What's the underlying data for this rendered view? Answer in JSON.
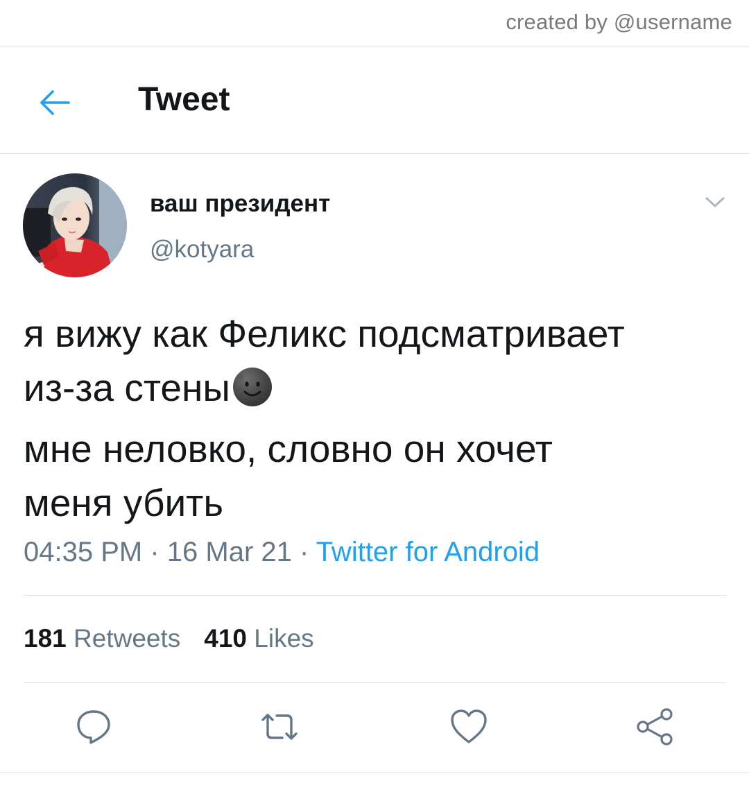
{
  "watermark": "created by @username",
  "header": {
    "title": "Tweet",
    "back_icon": "arrow-left-icon"
  },
  "tweet": {
    "author": {
      "display_name": "ваш президент",
      "handle": "@kotyara"
    },
    "text_lines": [
      "я вижу как Феликс подсматривает",
      "из-за стены",
      "мне неловко, словно он хочет",
      "меня убить"
    ],
    "emoji": "new-moon-face-emoji",
    "time": "04:35 PM",
    "date": "16 Mar 21",
    "separator": " · ",
    "source": "Twitter for Android",
    "stats": {
      "retweets_count": "181",
      "retweets_label": "Retweets",
      "likes_count": "410",
      "likes_label": "Likes"
    }
  },
  "actions": [
    {
      "name": "reply",
      "icon": "reply-icon"
    },
    {
      "name": "retweet",
      "icon": "retweet-icon"
    },
    {
      "name": "like",
      "icon": "heart-icon"
    },
    {
      "name": "share",
      "icon": "share-icon"
    }
  ],
  "colors": {
    "accent": "#1da1f2",
    "text_primary": "#14171a",
    "text_secondary": "#657786",
    "divider": "#e1e4e6"
  }
}
